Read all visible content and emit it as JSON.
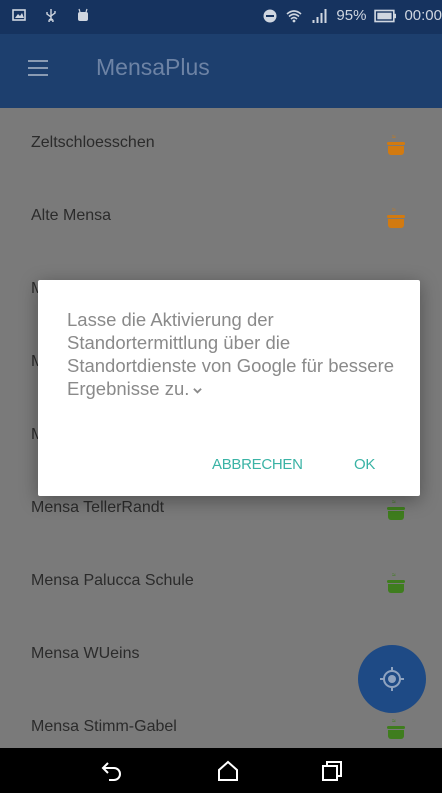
{
  "status_bar": {
    "battery": "95%",
    "time": "00:00"
  },
  "app_bar": {
    "title": "MensaPlus"
  },
  "list": {
    "items": [
      {
        "label": "Zeltschloesschen",
        "pot_color": "#d27a10"
      },
      {
        "label": "Alte Mensa",
        "pot_color": "#d27a10"
      },
      {
        "label": "M",
        "pot_color": "#3f7d1e"
      },
      {
        "label": "M",
        "pot_color": "#d27a10"
      },
      {
        "label": "M",
        "pot_color": "#d27a10"
      },
      {
        "label": "Mensa TellerRandt",
        "pot_color": "#3f7d1e"
      },
      {
        "label": "Mensa Palucca Schule",
        "pot_color": "#3f7d1e"
      },
      {
        "label": "Mensa WUeins",
        "pot_color": "#3f7d1e"
      },
      {
        "label": "Mensa Stimm-Gabel",
        "pot_color": "#3f7d1e"
      }
    ]
  },
  "dialog": {
    "message": "Lasse die Aktivierung der Standortermittlung über die Standortdienste von Google für bessere Ergebnisse zu.",
    "cancel_label": "ABBRECHEN",
    "ok_label": "OK"
  },
  "fab": {
    "icon": "my-location-icon"
  },
  "nav_bar": {
    "icons": [
      "back-icon",
      "home-icon",
      "recents-icon"
    ]
  }
}
